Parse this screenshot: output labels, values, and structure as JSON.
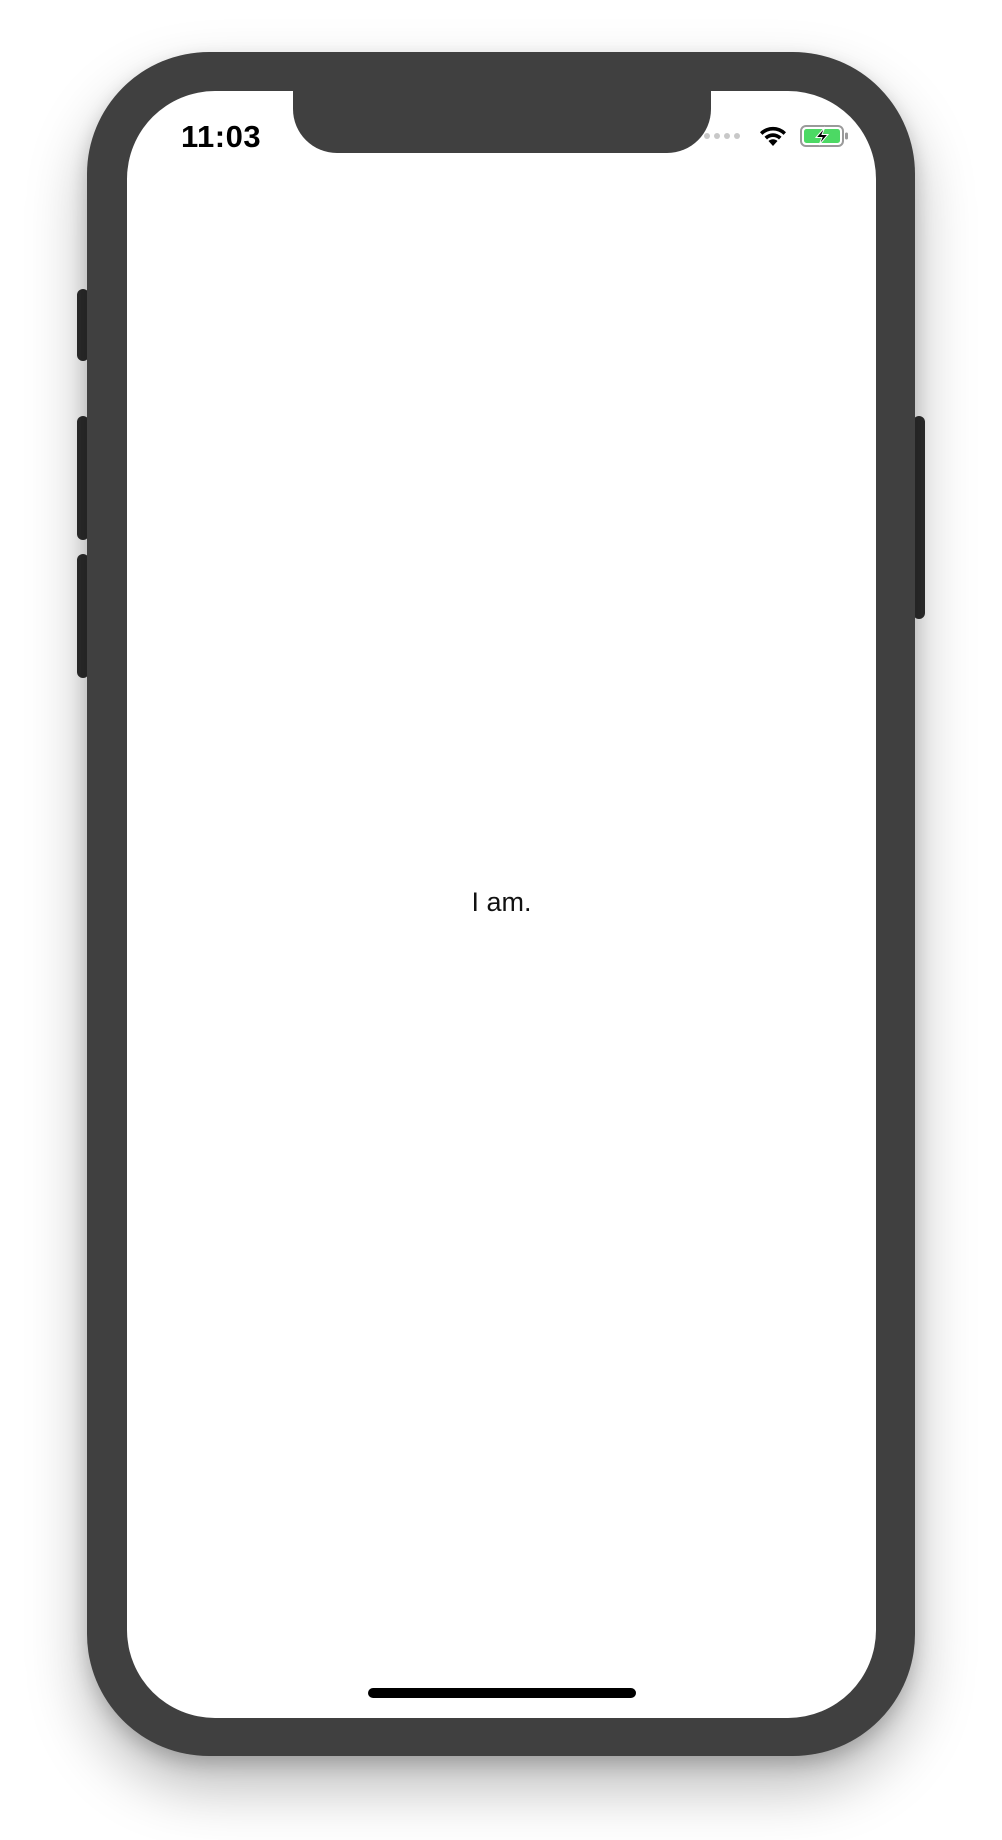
{
  "status_bar": {
    "time": "11:03",
    "signal_icon": "signal-dots-icon",
    "wifi_icon": "wifi-icon",
    "battery_icon": "battery-charging-icon",
    "battery_fill_color": "#4cd964"
  },
  "content": {
    "text": "I am."
  },
  "device": {
    "frame_color": "#404040",
    "button_color": "#2e2e2e"
  }
}
